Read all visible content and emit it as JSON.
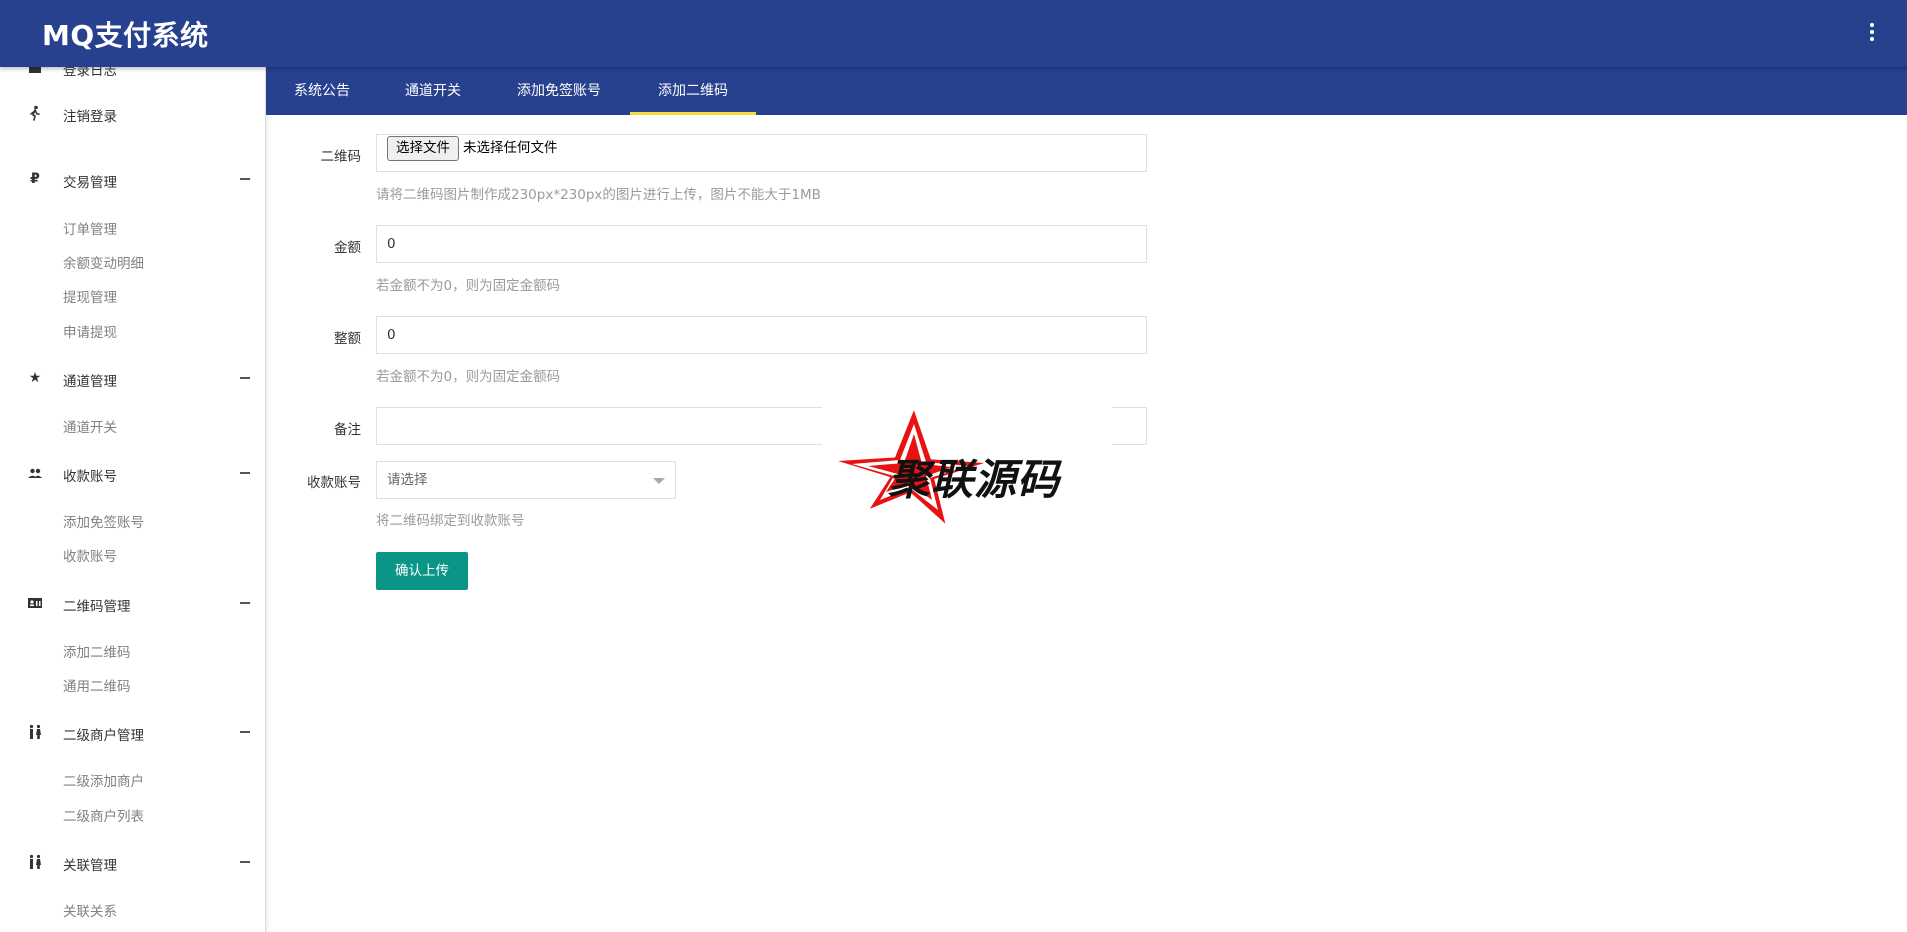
{
  "app": {
    "title": "MQ支付系统"
  },
  "sidebar": {
    "partial_top_label": "登录日志",
    "logout_label": "注销登录",
    "groups": [
      {
        "label": "交易管理",
        "icon": "currency-icon",
        "items": [
          "订单管理",
          "余额变动明细",
          "提现管理",
          "申请提现"
        ]
      },
      {
        "label": "通道管理",
        "icon": "star-icon",
        "items": [
          "通道开关"
        ]
      },
      {
        "label": "收款账号",
        "icon": "people-icon",
        "items": [
          "添加免签账号",
          "收款账号"
        ]
      },
      {
        "label": "二维码管理",
        "icon": "id-card-icon",
        "items": [
          "添加二维码",
          "通用二维码"
        ]
      },
      {
        "label": "二级商户管理",
        "icon": "wc-icon",
        "items": [
          "二级添加商户",
          "二级商户列表"
        ]
      },
      {
        "label": "关联管理",
        "icon": "wc-icon",
        "items": [
          "关联关系"
        ]
      }
    ]
  },
  "tabs": [
    {
      "label": "系统公告",
      "active": false
    },
    {
      "label": "通道开关",
      "active": false
    },
    {
      "label": "添加免签账号",
      "active": false
    },
    {
      "label": "添加二维码",
      "active": true
    }
  ],
  "form": {
    "qrcode": {
      "label": "二维码",
      "button_label": "选择文件",
      "status": "未选择任何文件",
      "help": "请将二维码图片制作成230px*230px的图片进行上传，图片不能大于1MB"
    },
    "amount": {
      "label": "金额",
      "value": "0",
      "help": "若金额不为0，则为固定金额码"
    },
    "whole_amount": {
      "label": "整额",
      "value": "0",
      "help": "若金额不为0，则为固定金额码"
    },
    "remark": {
      "label": "备注",
      "value": ""
    },
    "account": {
      "label": "收款账号",
      "placeholder": "请选择",
      "help": "将二维码绑定到收款账号"
    },
    "submit_label": "确认上传"
  },
  "watermark": {
    "text": "聚联源码"
  },
  "colors": {
    "primary": "#27418f",
    "tab_indicator": "#f2de3d",
    "submit": "#0a9586"
  }
}
